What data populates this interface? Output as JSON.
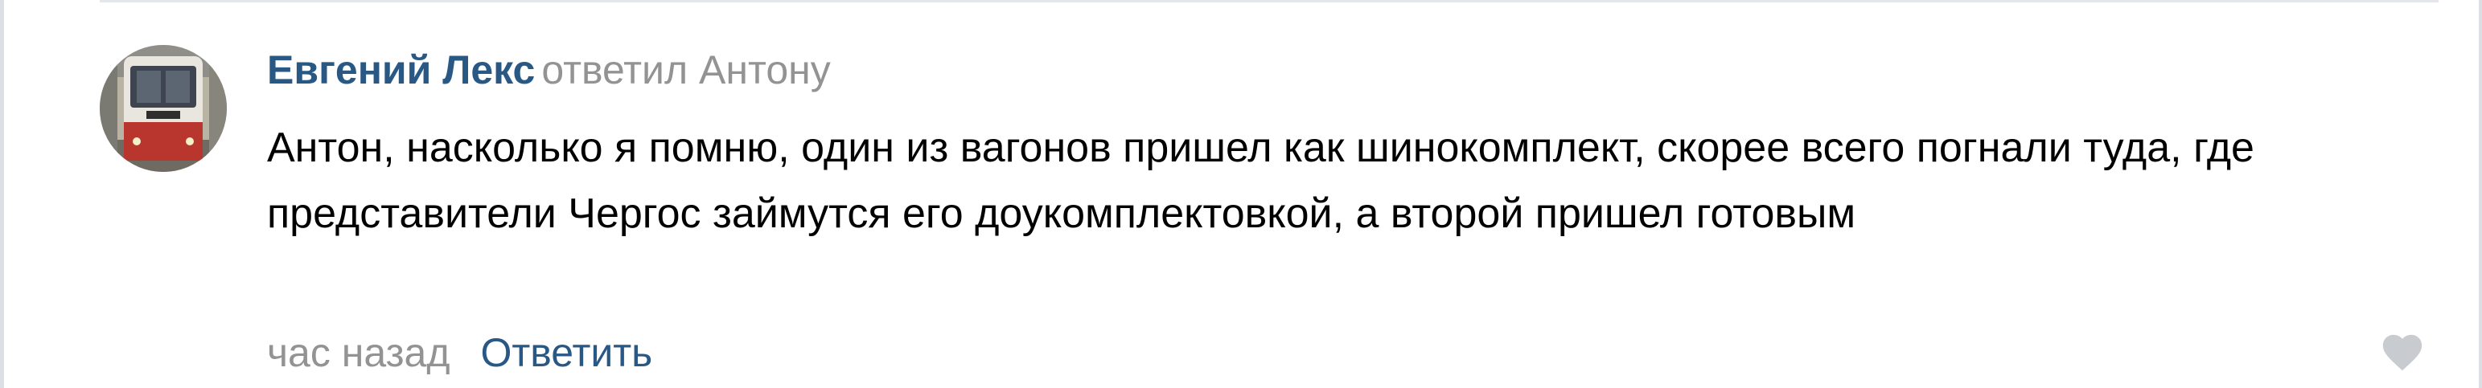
{
  "comment": {
    "author": "Евгений Лекс",
    "reply_to": "ответил Антону",
    "text": "Антон, насколько я помню, один из вагонов пришел как шинокомплект, скорее всего погнали туда, где представители Чергос займутся его доукомплектовкой, а второй пришел готовым",
    "time": "час назад",
    "reply_label": "Ответить",
    "like_icon": "heart-icon",
    "avatar_icon": "tram-photo"
  },
  "colors": {
    "link": "#2a5885",
    "muted": "#939393",
    "text": "#000000",
    "like": "#c8ccd1"
  }
}
